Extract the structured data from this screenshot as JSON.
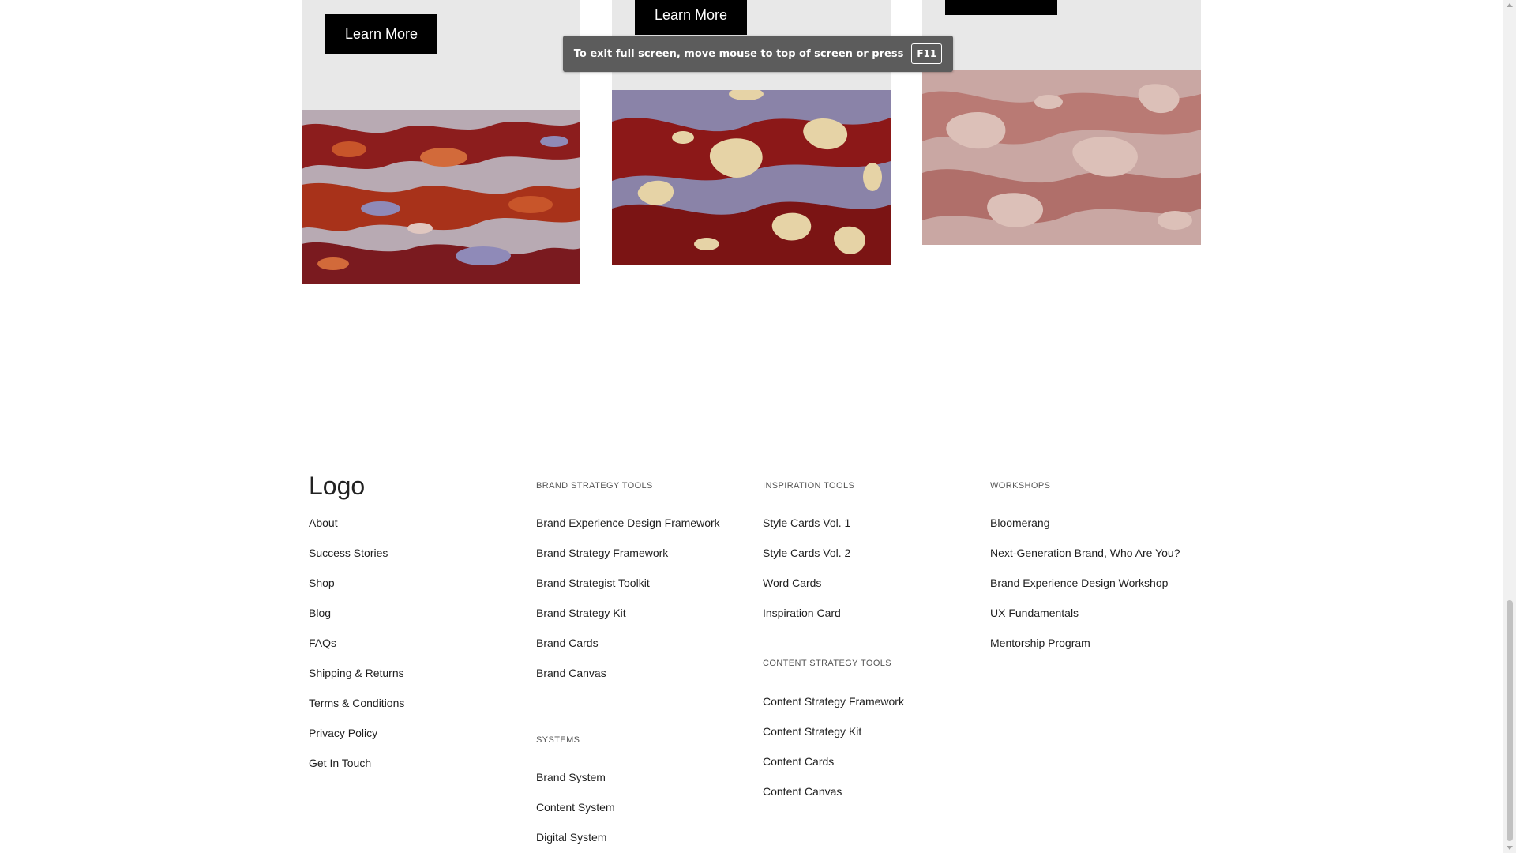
{
  "cards": [
    {
      "button_label": "Learn More"
    },
    {
      "button_label": "Learn More"
    },
    {
      "button_label": ""
    }
  ],
  "fullscreen_toast": {
    "message": "To exit full screen, move mouse to top of screen or press",
    "key": "F11"
  },
  "footer": {
    "logo": "Logo",
    "main_links": [
      "About",
      "Success Stories",
      "Shop",
      "Blog",
      "FAQs",
      "Shipping & Returns",
      "Terms & Conditions",
      "Privacy Policy",
      "Get In Touch"
    ],
    "brand_strategy_tools": {
      "heading": "BRAND STRATEGY TOOLS",
      "links": [
        "Brand Experience Design Framework",
        "Brand Strategy Framework",
        "Brand Strategist Toolkit",
        "Brand Strategy Kit",
        "Brand Cards",
        "Brand Canvas"
      ]
    },
    "systems": {
      "heading": "SYSTEMS",
      "links": [
        "Brand System",
        "Content System",
        "Digital System"
      ]
    },
    "inspiration_tools": {
      "heading": "INSPIRATION TOOLS",
      "links": [
        "Style Cards Vol. 1",
        "Style Cards Vol. 2",
        "Word Cards",
        "Inspiration Card"
      ]
    },
    "content_strategy_tools": {
      "heading": "CONTENT STRATEGY TOOLS",
      "links": [
        "Content Strategy Framework",
        "Content Strategy Kit",
        "Content Cards",
        "Content Canvas"
      ]
    },
    "workshops": {
      "heading": "WORKSHOPS",
      "links": [
        "Bloomerang",
        "Next-Generation Brand, Who Are You?",
        "Brand Experience Design Workshop",
        "UX Fundamentals",
        "Mentorship Program"
      ]
    }
  },
  "colors": {
    "card_background": "#e8e8e8",
    "button_background": "#000000",
    "toast_background": "#5c5c5c"
  }
}
